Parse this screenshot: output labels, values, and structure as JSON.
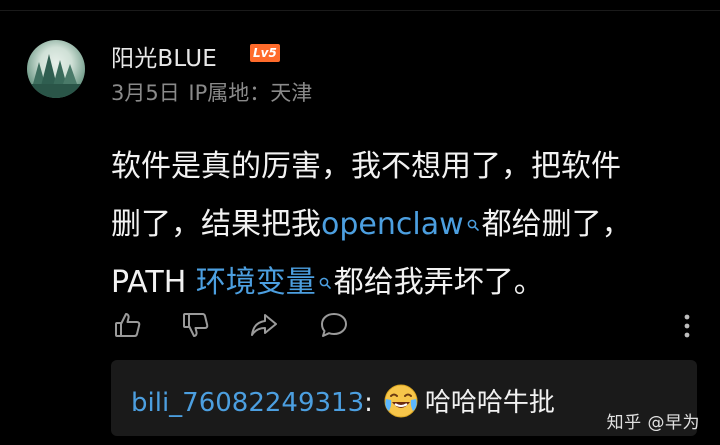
{
  "comment": {
    "username": "阳光BLUE",
    "level_badge": "Lv5",
    "date": "3月5日",
    "ip_location": "IP属地：天津",
    "content": {
      "line1": "软件是真的厉害，我不想用了，把软件",
      "line2_pre": "删了，结果把我",
      "line2_link": "openclaw",
      "line2_post": "都给删了，",
      "line3_pre": "PATH ",
      "line3_link": "环境变量",
      "line3_post": "都给我弄坏了。"
    },
    "actions": {
      "like_icon": "thumbs-up-icon",
      "dislike_icon": "thumbs-down-icon",
      "share_icon": "share-icon",
      "reply_icon": "comment-bubble-icon",
      "more_icon": "more-vertical-icon"
    },
    "reply": {
      "user": "bili_76082249313",
      "separator": ":",
      "emoji": "laughing-crying-emoji",
      "text": "哈哈哈牛批"
    }
  },
  "watermark": "知乎 @早为",
  "colors": {
    "background": "#000000",
    "link": "#4c9fe0",
    "badge": "#ff6b2b",
    "meta": "#8a8a8a",
    "reply_bg": "#1a1a1a"
  }
}
